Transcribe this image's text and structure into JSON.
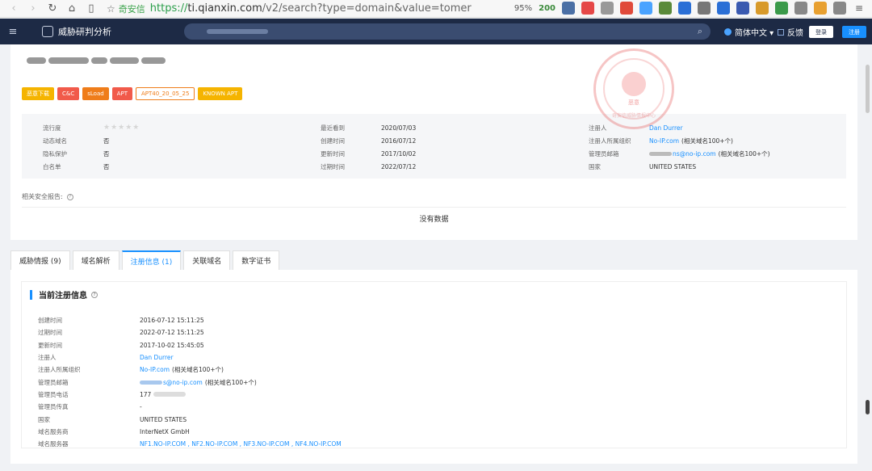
{
  "browser": {
    "brand": "奇安信",
    "url_scheme": "https://",
    "url_host": "ti.qianxin.com",
    "url_rest": "/v2/search?type=domain&value=tomer",
    "zoom": "95%",
    "badge_count": "200"
  },
  "header": {
    "app_title": "威胁研判分析",
    "language": "简体中文 ▾",
    "feedback": "反馈",
    "login": "登录",
    "register": "注册"
  },
  "tags": [
    "恶意下载",
    "C&C",
    "sLoad",
    "APT",
    "APT40_20_05_25",
    "KNOWN APT"
  ],
  "overview": {
    "col1": [
      {
        "label": "流行度",
        "value": "★★★★★"
      },
      {
        "label": "动态域名",
        "value": "否"
      },
      {
        "label": "隐私保护",
        "value": "否"
      },
      {
        "label": "白名单",
        "value": "否"
      }
    ],
    "col2": [
      {
        "label": "最近看到",
        "value": "2020/07/03"
      },
      {
        "label": "创建时间",
        "value": "2016/07/12"
      },
      {
        "label": "更新时间",
        "value": "2017/10/02"
      },
      {
        "label": "过期时间",
        "value": "2022/07/12"
      }
    ],
    "col3": {
      "registrant_label": "注册人",
      "registrant": "Dan Durrer",
      "org_label": "注册人所属组织",
      "org": "No-IP.com",
      "org_note": "(相关域名100+个)",
      "email_label": "管理员邮箱",
      "email": "ns@no-ip.com",
      "email_note": "(相关域名100+个)",
      "country_label": "国家",
      "country": "UNITED STATES"
    },
    "stamp": {
      "label": "恶意",
      "ring": "奇安信威胁情报中心"
    }
  },
  "related_reports": {
    "label": "相关安全报告:",
    "empty": "没有数据"
  },
  "tabs": [
    {
      "label": "威胁情报 (9)"
    },
    {
      "label": "域名解析"
    },
    {
      "label": "注册信息 (1)"
    },
    {
      "label": "关联域名"
    },
    {
      "label": "数字证书"
    }
  ],
  "registration": {
    "title": "当前注册信息",
    "created_label": "创建时间",
    "created": "2016-07-12 15:11:25",
    "expires_label": "过期时间",
    "expires": "2022-07-12 15:11:25",
    "updated_label": "更新时间",
    "updated": "2017-10-02 15:45:05",
    "registrant_label": "注册人",
    "registrant": "Dan Durrer",
    "org_label": "注册人所属组织",
    "org": "No-IP.com",
    "org_note": "(相关域名100+个)",
    "email_label": "管理员邮箱",
    "email": "s@no-ip.com",
    "email_note": "(相关域名100+个)",
    "phone_label": "管理员电话",
    "phone": "177",
    "fax_label": "管理员传真",
    "fax": "-",
    "country_label": "国家",
    "country": "UNITED STATES",
    "registrar_label": "域名服务商",
    "registrar": "InterNetX GmbH",
    "ns_label": "域名服务器",
    "ns": "NF1.NO-IP.COM , NF2.NO-IP.COM , NF3.NO-IP.COM , NF4.NO-IP.COM"
  }
}
